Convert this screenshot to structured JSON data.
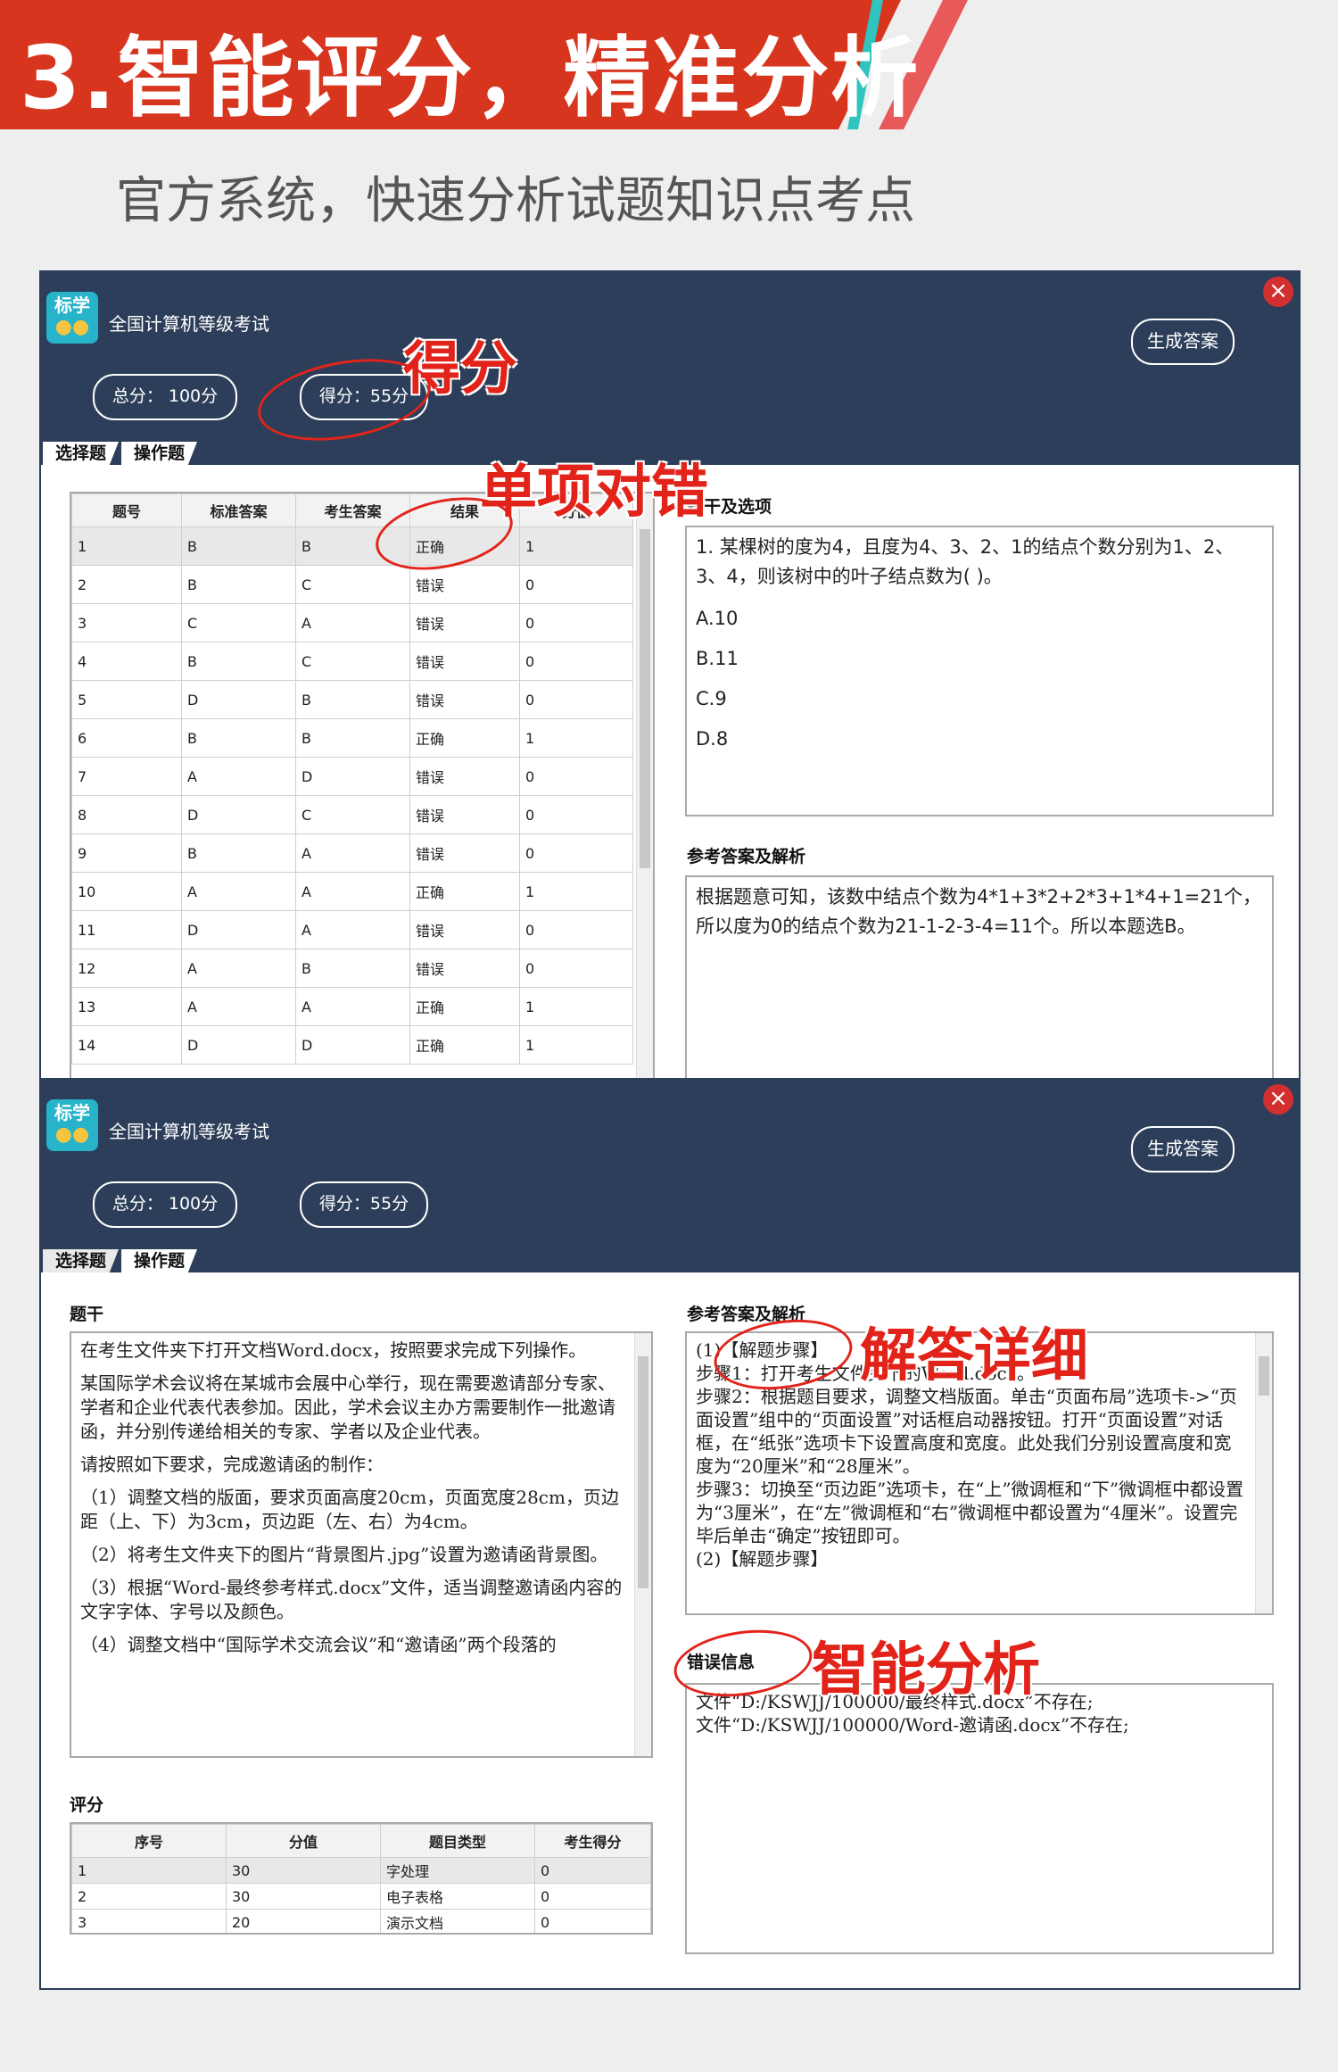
{
  "banner": {
    "title": "3.智能评分，精准分析",
    "subtitle": "官方系统，快速分析试题知识点考点"
  },
  "colors": {
    "banner_red": "#d8351f",
    "stripe_teal": "#2fc4c0",
    "window_navy": "#2c3e59",
    "annotation_red": "#e2231a"
  },
  "window1": {
    "logo": {
      "text": "标学",
      "icon": "owl-icon"
    },
    "title": "全国计算机等级考试",
    "generate_button": "生成答案",
    "total_pill": "总分：  100分",
    "score_pill": "得分：55分",
    "tabs": [
      "选择题",
      "操作题"
    ],
    "table": {
      "headers": [
        "题号",
        "标准答案",
        "考生答案",
        "结果",
        "分值"
      ],
      "rows": [
        [
          "1",
          "B",
          "B",
          "正确",
          "1"
        ],
        [
          "2",
          "B",
          "C",
          "错误",
          "0"
        ],
        [
          "3",
          "C",
          "A",
          "错误",
          "0"
        ],
        [
          "4",
          "B",
          "C",
          "错误",
          "0"
        ],
        [
          "5",
          "D",
          "B",
          "错误",
          "0"
        ],
        [
          "6",
          "B",
          "B",
          "正确",
          "1"
        ],
        [
          "7",
          "A",
          "D",
          "错误",
          "0"
        ],
        [
          "8",
          "D",
          "C",
          "错误",
          "0"
        ],
        [
          "9",
          "B",
          "A",
          "错误",
          "0"
        ],
        [
          "10",
          "A",
          "A",
          "正确",
          "1"
        ],
        [
          "11",
          "D",
          "A",
          "错误",
          "0"
        ],
        [
          "12",
          "A",
          "B",
          "错误",
          "0"
        ],
        [
          "13",
          "A",
          "A",
          "正确",
          "1"
        ],
        [
          "14",
          "D",
          "D",
          "正确",
          "1"
        ]
      ]
    },
    "stem_label": "题干及选项",
    "question": "1. 某棵树的度为4，且度为4、3、2、1的结点个数分别为1、2、3、4，则该树中的叶子结点数为( )。",
    "options": [
      "A.10",
      "B.11",
      "C.9",
      "D.8"
    ],
    "answer_label": "参考答案及解析",
    "answer_text": "根据题意可知，该数中结点个数为4*1+3*2+2*3+1*4+1=21个，所以度为0的结点个数为21-1-2-3-4=11个。所以本题选B。"
  },
  "window2": {
    "logo": {
      "text": "标学",
      "icon": "owl-icon"
    },
    "title": "全国计算机等级考试",
    "generate_button": "生成答案",
    "total_pill": "总分：  100分",
    "score_pill": "得分：55分",
    "tabs": [
      "选择题",
      "操作题"
    ],
    "stem_label": "题干",
    "stem_paragraphs": [
      "在考生文件夹下打开文档Word.docx，按照要求完成下列操作。",
      "某国际学术会议将在某城市会展中心举行，现在需要邀请部分专家、学者和企业代表代表参加。因此，学术会议主办方需要制作一批邀请函，并分别传递给相关的专家、学者以及企业代表。",
      "请按照如下要求，完成邀请函的制作：",
      "（1）调整文档的版面，要求页面高度20cm，页面宽度28cm，页边距（上、下）为3cm，页边距（左、右）为4cm。",
      "（2）将考生文件夹下的图片“背景图片.jpg”设置为邀请函背景图。",
      "（3）根据“Word-最终参考样式.docx”文件，适当调整邀请函内容的文字字体、字号以及颜色。",
      "（4）调整文档中“国际学术交流会议”和“邀请函”两个段落的"
    ],
    "answer_label": "参考答案及解析",
    "answer_lines": [
      "(1)【解题步骤】",
      "步骤1：打开考生文件夹下的Word.docx。",
      "步骤2：根据题目要求，调整文档版面。单击“页面布局”选项卡->“页面设置”组中的“页面设置”对话框启动器按钮。打开“页面设置”对话框，在“纸张”选项卡下设置高度和宽度。此处我们分别设置高度和宽度为“20厘米”和“28厘米”。",
      "步骤3：切换至“页边距”选项卡，在“上”微调框和“下”微调框中都设置为“3厘米”，在“左”微调框和“右”微调框中都设置为“4厘米”。设置完毕后单击“确定”按钮即可。",
      "(2)【解题步骤】"
    ],
    "error_label": "错误信息",
    "error_lines": [
      "文件“D:/KSWJJ/100000/最终样式.docx”不存在;",
      "文件“D:/KSWJJ/100000/Word-邀请函.docx”不存在;"
    ],
    "score_label": "评分",
    "score_table": {
      "headers": [
        "序号",
        "分值",
        "题目类型",
        "考生得分"
      ],
      "rows": [
        [
          "1",
          "30",
          "字处理",
          "0"
        ],
        [
          "2",
          "30",
          "电子表格",
          "0"
        ],
        [
          "3",
          "20",
          "演示文档",
          "0"
        ]
      ]
    }
  },
  "annotations": {
    "score": "得分",
    "single_item": "单项对错",
    "detail": "解答详细",
    "smart": "智能分析"
  }
}
